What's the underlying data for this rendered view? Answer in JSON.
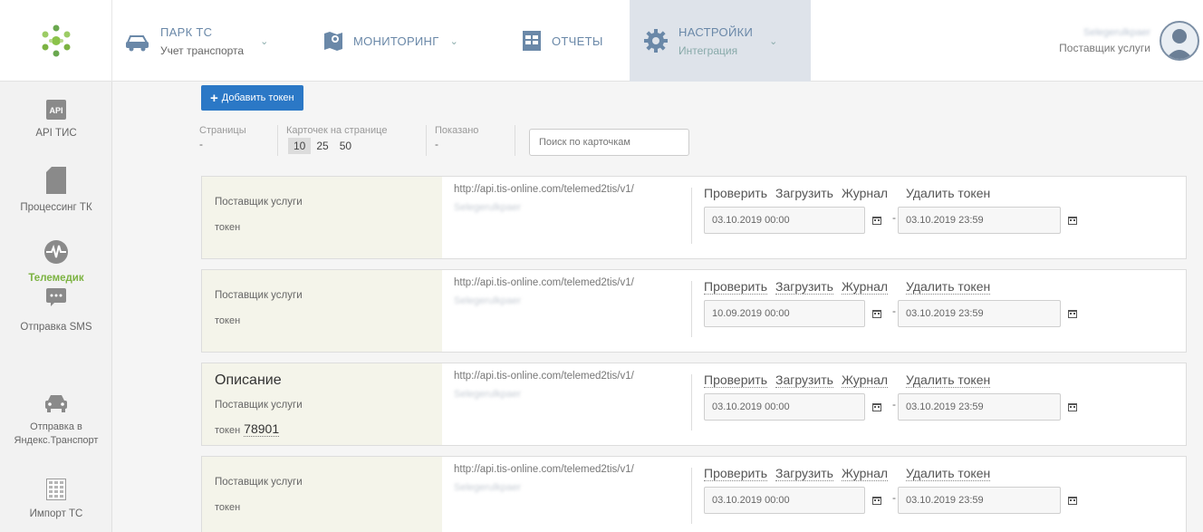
{
  "header": {
    "nav": [
      {
        "title": "ПАРК ТС",
        "subtitle": "Учет транспорта",
        "icon": "car-icon"
      },
      {
        "title": "МОНИТОРИНГ",
        "subtitle": "",
        "icon": "map-pin-icon"
      },
      {
        "title": "ОТЧЕТЫ",
        "subtitle": "",
        "icon": "report-icon"
      },
      {
        "title": "НАСТРОЙКИ",
        "subtitle": "Интеграция",
        "icon": "gear-icon"
      }
    ],
    "user": {
      "name": "Selegerulkpaer",
      "role": "Поставщик услуги"
    }
  },
  "sidebar": {
    "items": [
      {
        "label": "API ТИС",
        "icon": "api-icon",
        "active": false
      },
      {
        "label": "Процессинг ТК",
        "icon": "card-icon",
        "active": false
      },
      {
        "label": "Телемедик",
        "icon": "heartbeat-icon",
        "active": true
      },
      {
        "label": "Отправка SMS",
        "icon": "sms-icon",
        "active": false
      },
      {
        "label": "Отправка в Яндекс.Транспорт",
        "icon": "car-front-icon",
        "active": false
      },
      {
        "label": "Импорт ТС",
        "icon": "import-table-icon",
        "active": false
      }
    ]
  },
  "toolbar": {
    "add_label": "Добавить токен",
    "pages_label": "Страницы",
    "pages_value": "-",
    "per_page_label": "Карточек на странице",
    "per_page_options": [
      "10",
      "25",
      "50"
    ],
    "shown_label": "Показано",
    "shown_value": "-",
    "search_placeholder": "Поиск по карточкам"
  },
  "card_labels": {
    "provider": "Поставщик услуги",
    "token": "токен",
    "check": "Проверить",
    "load": "Загрузить",
    "journal": "Журнал",
    "delete": "Удалить токен",
    "dash": "-"
  },
  "cards": [
    {
      "title": "",
      "token_value": "",
      "url": "http://api.tis-online.com/telemed2tis/v1/",
      "blurred": "Selegerulkpaer",
      "date_from": "03.10.2019 00:00",
      "date_to": "03.10.2019 23:59"
    },
    {
      "title": "",
      "token_value": "",
      "url": "http://api.tis-online.com/telemed2tis/v1/",
      "blurred": "Selegerulkpaer",
      "date_from": "10.09.2019 00:00",
      "date_to": "03.10.2019 23:59"
    },
    {
      "title": "Описание",
      "token_value": "78901",
      "url": "http://api.tis-online.com/telemed2tis/v1/",
      "blurred": "Selegerulkpaer",
      "date_from": "03.10.2019 00:00",
      "date_to": "03.10.2019 23:59"
    },
    {
      "title": "",
      "token_value": "",
      "url": "http://api.tis-online.com/telemed2tis/v1/",
      "blurred": "Selegerulkpaer",
      "date_from": "03.10.2019 00:00",
      "date_to": "03.10.2019 23:59"
    }
  ],
  "colors": {
    "accent": "#2b78c6",
    "active_nav": "#dee3ea",
    "active_side": "#7cb342"
  }
}
